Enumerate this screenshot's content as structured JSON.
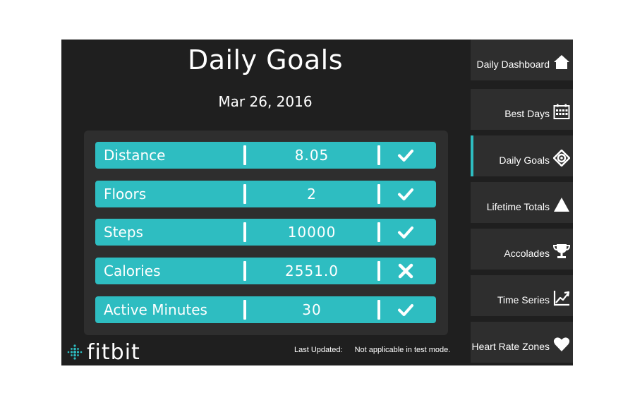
{
  "main": {
    "title": "Daily Goals",
    "date": "Mar 26, 2016"
  },
  "goals": [
    {
      "name": "Distance",
      "value": "8.05",
      "status": "met",
      "status_icon": "check-icon"
    },
    {
      "name": "Floors",
      "value": "2",
      "status": "met",
      "status_icon": "check-icon"
    },
    {
      "name": "Steps",
      "value": "10000",
      "status": "met",
      "status_icon": "check-icon"
    },
    {
      "name": "Calories",
      "value": "2551.0",
      "status": "not-met",
      "status_icon": "cross-icon"
    },
    {
      "name": "Active Minutes",
      "value": "30",
      "status": "met",
      "status_icon": "check-icon"
    }
  ],
  "footer": {
    "logo_text": "fitbit",
    "last_updated_label": "Last Updated:",
    "last_updated_value": "Not applicable in test mode."
  },
  "sidebar": {
    "items": [
      {
        "label": "Daily Dashboard",
        "icon": "home-icon",
        "active": false
      },
      {
        "label": "Best Days",
        "icon": "calendar-icon",
        "active": false
      },
      {
        "label": "Daily Goals",
        "icon": "target-icon",
        "active": true
      },
      {
        "label": "Lifetime Totals",
        "icon": "triangle-icon",
        "active": false
      },
      {
        "label": "Accolades",
        "icon": "trophy-icon",
        "active": false
      },
      {
        "label": "Time Series",
        "icon": "chart-trend-icon",
        "active": false
      },
      {
        "label": "Heart Rate Zones",
        "icon": "heart-icon",
        "active": false
      }
    ]
  },
  "colors": {
    "accent": "#2ebdc1",
    "background": "#1f1f1f",
    "panel": "#2e2e2e",
    "text": "#ffffff"
  }
}
